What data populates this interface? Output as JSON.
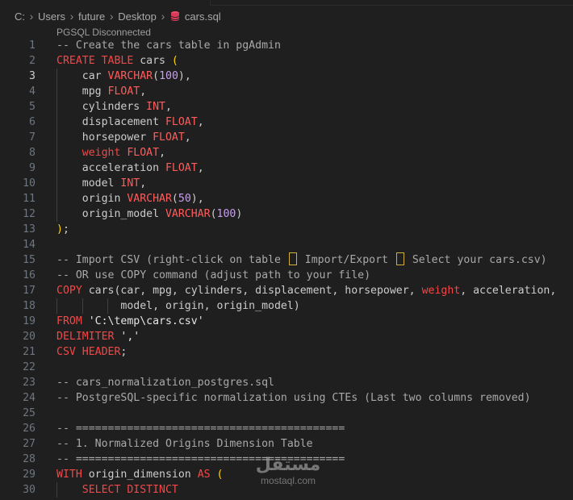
{
  "breadcrumb": {
    "drive": "C:",
    "users": "Users",
    "user": "future",
    "desktop": "Desktop",
    "file": "cars.sql"
  },
  "codelens": "PGSQL Disconnected",
  "lines": [
    {
      "num": "1",
      "segs": [
        {
          "c": "c",
          "t": "-- Create the cars table in pgAdmin"
        }
      ]
    },
    {
      "num": "2",
      "segs": [
        {
          "c": "k",
          "t": "CREATE TABLE"
        },
        {
          "c": "",
          "t": " cars "
        },
        {
          "c": "p",
          "t": "("
        }
      ]
    },
    {
      "num": "3",
      "current": true,
      "segs": [
        {
          "c": "",
          "t": "    car "
        },
        {
          "c": "t",
          "t": "VARCHAR"
        },
        {
          "c": "",
          "t": "("
        },
        {
          "c": "n",
          "t": "100"
        },
        {
          "c": "",
          "t": "),"
        }
      ]
    },
    {
      "num": "4",
      "segs": [
        {
          "c": "",
          "t": "    mpg "
        },
        {
          "c": "t",
          "t": "FLOAT"
        },
        {
          "c": "",
          "t": ","
        }
      ]
    },
    {
      "num": "5",
      "segs": [
        {
          "c": "",
          "t": "    cylinders "
        },
        {
          "c": "t",
          "t": "INT"
        },
        {
          "c": "",
          "t": ","
        }
      ]
    },
    {
      "num": "6",
      "segs": [
        {
          "c": "",
          "t": "    displacement "
        },
        {
          "c": "t",
          "t": "FLOAT"
        },
        {
          "c": "",
          "t": ","
        }
      ]
    },
    {
      "num": "7",
      "segs": [
        {
          "c": "",
          "t": "    horsepower "
        },
        {
          "c": "t",
          "t": "FLOAT"
        },
        {
          "c": "",
          "t": ","
        }
      ]
    },
    {
      "num": "8",
      "segs": [
        {
          "c": "",
          "t": "    "
        },
        {
          "c": "k",
          "t": "weight"
        },
        {
          "c": "",
          "t": " "
        },
        {
          "c": "t",
          "t": "FLOAT"
        },
        {
          "c": "",
          "t": ","
        }
      ]
    },
    {
      "num": "9",
      "segs": [
        {
          "c": "",
          "t": "    acceleration "
        },
        {
          "c": "t",
          "t": "FLOAT"
        },
        {
          "c": "",
          "t": ","
        }
      ]
    },
    {
      "num": "10",
      "segs": [
        {
          "c": "",
          "t": "    model "
        },
        {
          "c": "t",
          "t": "INT"
        },
        {
          "c": "",
          "t": ","
        }
      ]
    },
    {
      "num": "11",
      "segs": [
        {
          "c": "",
          "t": "    origin "
        },
        {
          "c": "t",
          "t": "VARCHAR"
        },
        {
          "c": "",
          "t": "("
        },
        {
          "c": "n",
          "t": "50"
        },
        {
          "c": "",
          "t": "),"
        }
      ]
    },
    {
      "num": "12",
      "segs": [
        {
          "c": "",
          "t": "    origin_model "
        },
        {
          "c": "t",
          "t": "VARCHAR"
        },
        {
          "c": "",
          "t": "("
        },
        {
          "c": "n",
          "t": "100"
        },
        {
          "c": "",
          "t": ")"
        }
      ]
    },
    {
      "num": "13",
      "segs": [
        {
          "c": "p",
          "t": ")"
        },
        {
          "c": "",
          "t": ";"
        }
      ]
    },
    {
      "num": "14",
      "segs": []
    },
    {
      "num": "15",
      "segs": [
        {
          "c": "c",
          "t": "-- Import CSV (right-click on table "
        },
        {
          "c": "box",
          "t": ""
        },
        {
          "c": "c",
          "t": " Import/Export "
        },
        {
          "c": "box",
          "t": ""
        },
        {
          "c": "c",
          "t": " Select your cars.csv)"
        }
      ]
    },
    {
      "num": "16",
      "segs": [
        {
          "c": "c",
          "t": "-- OR use COPY command (adjust path to your file)"
        }
      ]
    },
    {
      "num": "17",
      "segs": [
        {
          "c": "k",
          "t": "COPY"
        },
        {
          "c": "",
          "t": " cars(car, mpg, cylinders, displacement, horsepower, "
        },
        {
          "c": "k",
          "t": "weight"
        },
        {
          "c": "",
          "t": ", acceleration,"
        }
      ]
    },
    {
      "num": "18",
      "segs": [
        {
          "c": "",
          "t": "          model, origin, origin_model)"
        }
      ]
    },
    {
      "num": "19",
      "segs": [
        {
          "c": "k",
          "t": "FROM"
        },
        {
          "c": "",
          "t": " "
        },
        {
          "c": "s",
          "t": "'C:\\temp\\cars.csv'"
        }
      ]
    },
    {
      "num": "20",
      "segs": [
        {
          "c": "k",
          "t": "DELIMITER"
        },
        {
          "c": "",
          "t": " "
        },
        {
          "c": "s",
          "t": "','"
        }
      ]
    },
    {
      "num": "21",
      "segs": [
        {
          "c": "k",
          "t": "CSV HEADER"
        },
        {
          "c": "",
          "t": ";"
        }
      ]
    },
    {
      "num": "22",
      "segs": []
    },
    {
      "num": "23",
      "segs": [
        {
          "c": "c",
          "t": "-- cars_normalization_postgres.sql"
        }
      ]
    },
    {
      "num": "24",
      "segs": [
        {
          "c": "c",
          "t": "-- PostgreSQL-specific normalization using CTEs (Last two columns removed)"
        }
      ]
    },
    {
      "num": "25",
      "segs": []
    },
    {
      "num": "26",
      "segs": [
        {
          "c": "c",
          "t": "-- =========================================="
        }
      ]
    },
    {
      "num": "27",
      "segs": [
        {
          "c": "c",
          "t": "-- 1. Normalized Origins Dimension Table"
        }
      ]
    },
    {
      "num": "28",
      "segs": [
        {
          "c": "c",
          "t": "-- =========================================="
        }
      ]
    },
    {
      "num": "29",
      "segs": [
        {
          "c": "k",
          "t": "WITH"
        },
        {
          "c": "",
          "t": " origin_dimension "
        },
        {
          "c": "k",
          "t": "AS"
        },
        {
          "c": "",
          "t": " "
        },
        {
          "c": "p",
          "t": "("
        }
      ]
    },
    {
      "num": "30",
      "segs": [
        {
          "c": "",
          "t": "    "
        },
        {
          "c": "k",
          "t": "SELECT DISTINCT"
        }
      ]
    }
  ],
  "watermark": {
    "arabic": "مستقل",
    "latin": "mostaql.com"
  },
  "colors": {
    "background": "#1f1f1f",
    "keyword": "#f44747",
    "type": "#ff5c5c",
    "number": "#c7a0e8",
    "comment": "#a9a9a9",
    "bracket": "#ffd700",
    "db_icon": "#f14c6b"
  },
  "icons": {
    "separator": "chevron-right-icon",
    "file": "database-icon",
    "arrow_glyph": "unknown-glyph-box"
  }
}
